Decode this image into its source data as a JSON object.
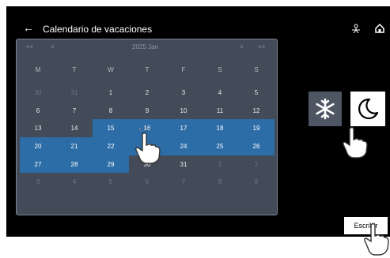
{
  "header": {
    "back_glyph": "←",
    "title": "Calendario de vacaciones",
    "person_icon": "person-icon",
    "home_icon": "home-icon"
  },
  "calendar": {
    "nav": {
      "prev_year": "<<",
      "prev_month": "<",
      "month_label": "2025 Jan",
      "next_month": ">",
      "next_year": ">>"
    },
    "weekdays": [
      "M",
      "T",
      "W",
      "T",
      "F",
      "S",
      "S"
    ],
    "days": [
      {
        "d": "30",
        "t": "other"
      },
      {
        "d": "31",
        "t": "other"
      },
      {
        "d": "1",
        "t": ""
      },
      {
        "d": "2",
        "t": ""
      },
      {
        "d": "3",
        "t": ""
      },
      {
        "d": "4",
        "t": ""
      },
      {
        "d": "5",
        "t": ""
      },
      {
        "d": "6",
        "t": ""
      },
      {
        "d": "7",
        "t": ""
      },
      {
        "d": "8",
        "t": ""
      },
      {
        "d": "9",
        "t": ""
      },
      {
        "d": "10",
        "t": ""
      },
      {
        "d": "11",
        "t": ""
      },
      {
        "d": "12",
        "t": ""
      },
      {
        "d": "13",
        "t": ""
      },
      {
        "d": "14",
        "t": ""
      },
      {
        "d": "15",
        "t": "sel"
      },
      {
        "d": "16",
        "t": "sel"
      },
      {
        "d": "17",
        "t": "sel"
      },
      {
        "d": "18",
        "t": "sel"
      },
      {
        "d": "19",
        "t": "sel"
      },
      {
        "d": "20",
        "t": "sel"
      },
      {
        "d": "21",
        "t": "sel"
      },
      {
        "d": "22",
        "t": "sel"
      },
      {
        "d": "23",
        "t": "sel"
      },
      {
        "d": "24",
        "t": "sel"
      },
      {
        "d": "25",
        "t": "sel"
      },
      {
        "d": "26",
        "t": "sel"
      },
      {
        "d": "27",
        "t": "sel"
      },
      {
        "d": "28",
        "t": "sel"
      },
      {
        "d": "29",
        "t": "sel"
      },
      {
        "d": "30",
        "t": ""
      },
      {
        "d": "31",
        "t": ""
      },
      {
        "d": "1",
        "t": "other"
      },
      {
        "d": "2",
        "t": "other"
      },
      {
        "d": "3",
        "t": "other"
      },
      {
        "d": "4",
        "t": "other"
      },
      {
        "d": "5",
        "t": "other"
      },
      {
        "d": "6",
        "t": "other"
      },
      {
        "d": "7",
        "t": "other"
      },
      {
        "d": "8",
        "t": "other"
      },
      {
        "d": "9",
        "t": "other"
      }
    ],
    "selected_color": "#2c6ca7"
  },
  "mode_buttons": {
    "snow_icon": "snowflake-icon",
    "moon_icon": "moon-icon"
  },
  "write_button": {
    "label": "Escribir"
  }
}
